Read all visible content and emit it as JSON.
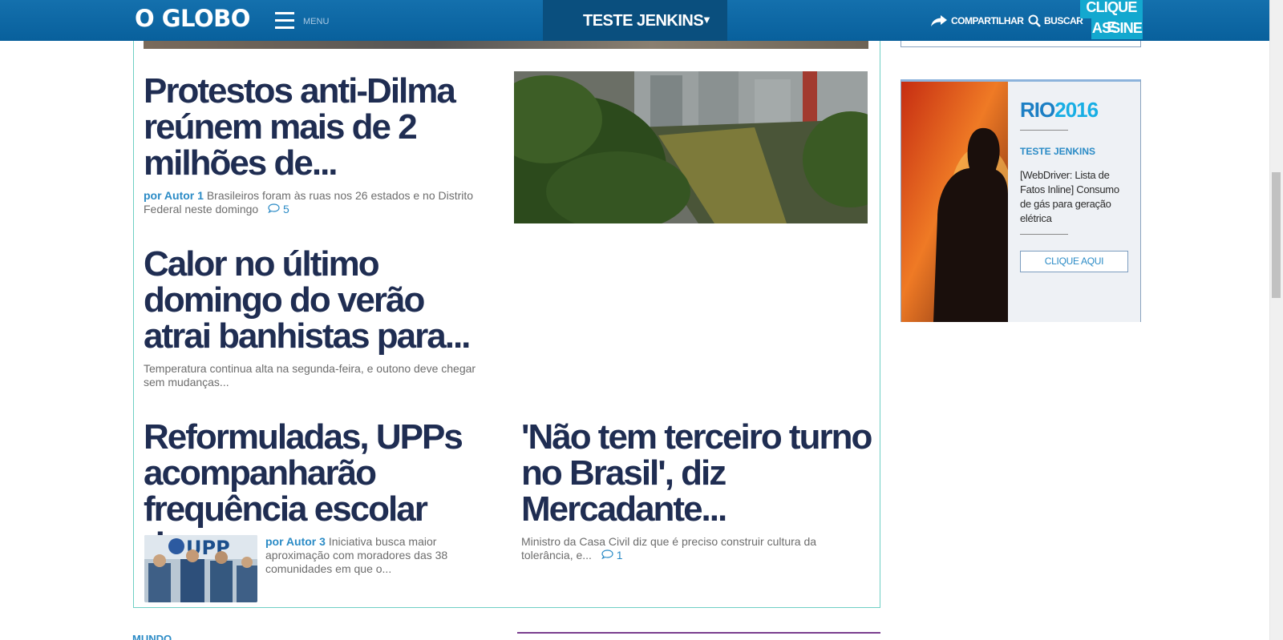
{
  "header": {
    "logo": "O GLOBO",
    "menu_label": "MENU",
    "section": "TESTE JENKINS",
    "share_label": "COMPARTILHAR",
    "search_label": "BUSCAR",
    "cta_line1": "CLIQUE E",
    "cta_line2": "ASSINE"
  },
  "articles": [
    {
      "headline": "Protestos anti-Dilma reúnem mais de 2 milhões de...",
      "byline": "por Autor 1",
      "dek": "Brasileiros foram às ruas nos 26 estados e no Distrito Federal neste domingo",
      "comments": "5"
    },
    {
      "headline": "Calor no último domingo do verão atrai banhistas para...",
      "dek": "Temperatura continua alta na segunda-feira, e outono deve chegar sem mudanças..."
    },
    {
      "headline": "Reformuladas, UPPs acompanharão frequência escolar de...",
      "byline": "por Autor 3",
      "dek": "Iniciativa busca maior aproximação com moradores das 38 comunidades em que o...",
      "image_text": "UPP"
    },
    {
      "headline": "'Não tem terceiro turno no Brasil', diz Mercadante...",
      "dek": "Ministro da Casa Civil diz que é preciso construir cultura da tolerância, e...",
      "comments": "1"
    }
  ],
  "ad": {
    "logo_main": "RIO",
    "logo_year": "2016",
    "section": "TESTE JENKINS",
    "text": "[WebDriver: Lista de Fatos Inline] Consumo de gás para geração elétrica",
    "button": "CLIQUE AQUI"
  },
  "bottom": {
    "section": "MUNDO"
  },
  "colors": {
    "header_blue": "#0d6aa6",
    "headline_navy": "#1f2d52",
    "link_blue": "#2b8bc6",
    "box_teal": "#6fcfc4",
    "cta_cyan": "#13a8cf"
  }
}
